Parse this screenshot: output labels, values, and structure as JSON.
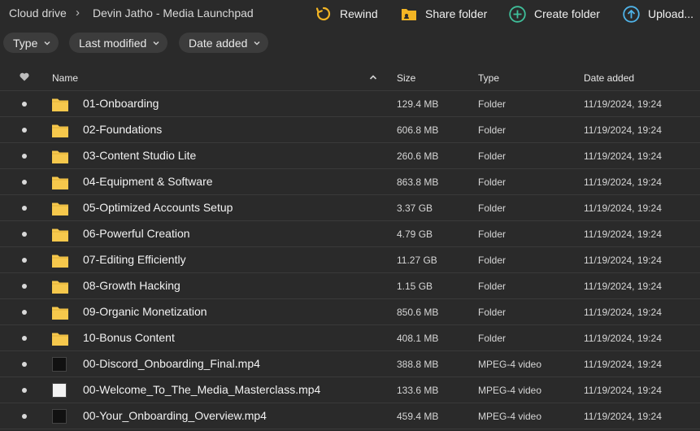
{
  "breadcrumb": {
    "root": "Cloud drive",
    "current": "Devin Jatho - Media Launchpad"
  },
  "actions": {
    "rewind": "Rewind",
    "share": "Share folder",
    "create": "Create folder",
    "upload": "Upload..."
  },
  "filters": {
    "type": "Type",
    "modified": "Last modified",
    "added": "Date added"
  },
  "columns": {
    "name": "Name",
    "size": "Size",
    "type": "Type",
    "date": "Date added"
  },
  "rows": [
    {
      "name": "01-Onboarding",
      "size": "129.4 MB",
      "type": "Folder",
      "date": "11/19/2024, 19:24"
    },
    {
      "name": "02-Foundations",
      "size": "606.8 MB",
      "type": "Folder",
      "date": "11/19/2024, 19:24"
    },
    {
      "name": "03-Content Studio Lite",
      "size": "260.6 MB",
      "type": "Folder",
      "date": "11/19/2024, 19:24"
    },
    {
      "name": "04-Equipment & Software",
      "size": "863.8 MB",
      "type": "Folder",
      "date": "11/19/2024, 19:24"
    },
    {
      "name": "05-Optimized Accounts Setup",
      "size": "3.37 GB",
      "type": "Folder",
      "date": "11/19/2024, 19:24"
    },
    {
      "name": "06-Powerful Creation",
      "size": "4.79 GB",
      "type": "Folder",
      "date": "11/19/2024, 19:24"
    },
    {
      "name": "07-Editing Efficiently",
      "size": "11.27 GB",
      "type": "Folder",
      "date": "11/19/2024, 19:24"
    },
    {
      "name": "08-Growth Hacking",
      "size": "1.15 GB",
      "type": "Folder",
      "date": "11/19/2024, 19:24"
    },
    {
      "name": "09-Organic Monetization",
      "size": "850.6 MB",
      "type": "Folder",
      "date": "11/19/2024, 19:24"
    },
    {
      "name": "10-Bonus Content",
      "size": "408.1 MB",
      "type": "Folder",
      "date": "11/19/2024, 19:24"
    },
    {
      "name": "00-Discord_Onboarding_Final.mp4",
      "size": "388.8 MB",
      "type": "MPEG-4 video",
      "date": "11/19/2024, 19:24"
    },
    {
      "name": "00-Welcome_To_The_Media_Masterclass.mp4",
      "size": "133.6 MB",
      "type": "MPEG-4 video",
      "date": "11/19/2024, 19:24"
    },
    {
      "name": "00-Your_Onboarding_Overview.mp4",
      "size": "459.4 MB",
      "type": "MPEG-4 video",
      "date": "11/19/2024, 19:24"
    }
  ],
  "colors": {
    "background": "#2a2a2a",
    "folder": "#f6c84c",
    "rewind": "#f3b524",
    "share": "#f3b524",
    "create": "#3fbf9a",
    "upload": "#4fb3e8"
  },
  "icons": {
    "rewind": "rewind-icon",
    "share": "share-folder-icon",
    "create": "create-folder-icon",
    "upload": "upload-icon",
    "favorite": "heart-icon",
    "sort": "sort-asc-icon"
  }
}
